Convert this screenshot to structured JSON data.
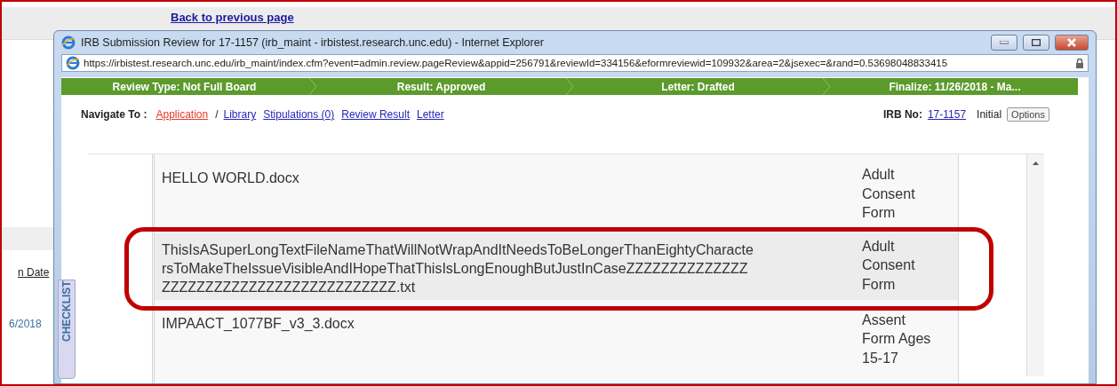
{
  "background_page": {
    "back_link": "Back to previous page",
    "column_header": "n Date",
    "date_cell": "6/2018",
    "checklist_tab": "CHECKLIST"
  },
  "window": {
    "title": "IRB Submission Review for 17-1157 (irb_maint - irbistest.research.unc.edu) - Internet Explorer",
    "url": "https://irbistest.research.unc.edu/irb_maint/index.cfm?event=admin.review.pageReview&appid=256791&reviewId=334156&eformreviewid=109932&area=2&jsexec=&rand=0.53698048833415"
  },
  "progress_steps": [
    {
      "label": "Review Type: Not Full Board"
    },
    {
      "label": "Result: Approved"
    },
    {
      "label": "Letter: Drafted"
    },
    {
      "label": "Finalize: 11/26/2018 - Ma..."
    }
  ],
  "navigation": {
    "label": "Navigate To :",
    "links": [
      {
        "label": "Application",
        "selected": true
      },
      {
        "label": "Library",
        "prefix": "/",
        "selected": false
      },
      {
        "label": "Stipulations (0)",
        "selected": false
      },
      {
        "label": "Review Result",
        "selected": false
      },
      {
        "label": "Letter",
        "selected": false
      }
    ]
  },
  "irb": {
    "label": "IRB No:",
    "number": "17-1157",
    "status": "Initial",
    "options_button": "Options"
  },
  "documents": [
    {
      "file_name": "HELLO WORLD.docx",
      "type": "Adult Consent Form",
      "selected": false,
      "highlighted": false
    },
    {
      "file_name": "ThisIsASuperLongTextFileNameThatWillNotWrapAndItNeedsToBeLongerThanEightyCharactersToMakeTheIssueVisibleAndIHopeThatThisIsLongEnoughButJustInCaseZZZZZZZZZZZZZZZZZZZZZZZZZZZZZZZZZZZZZZZZZ.txt",
      "type": "Adult Consent Form",
      "selected": true,
      "highlighted": true
    },
    {
      "file_name": "IMPAACT_1077BF_v3_3.docx",
      "type": "Assent Form Ages 15-17",
      "selected": false,
      "highlighted": false
    }
  ]
}
